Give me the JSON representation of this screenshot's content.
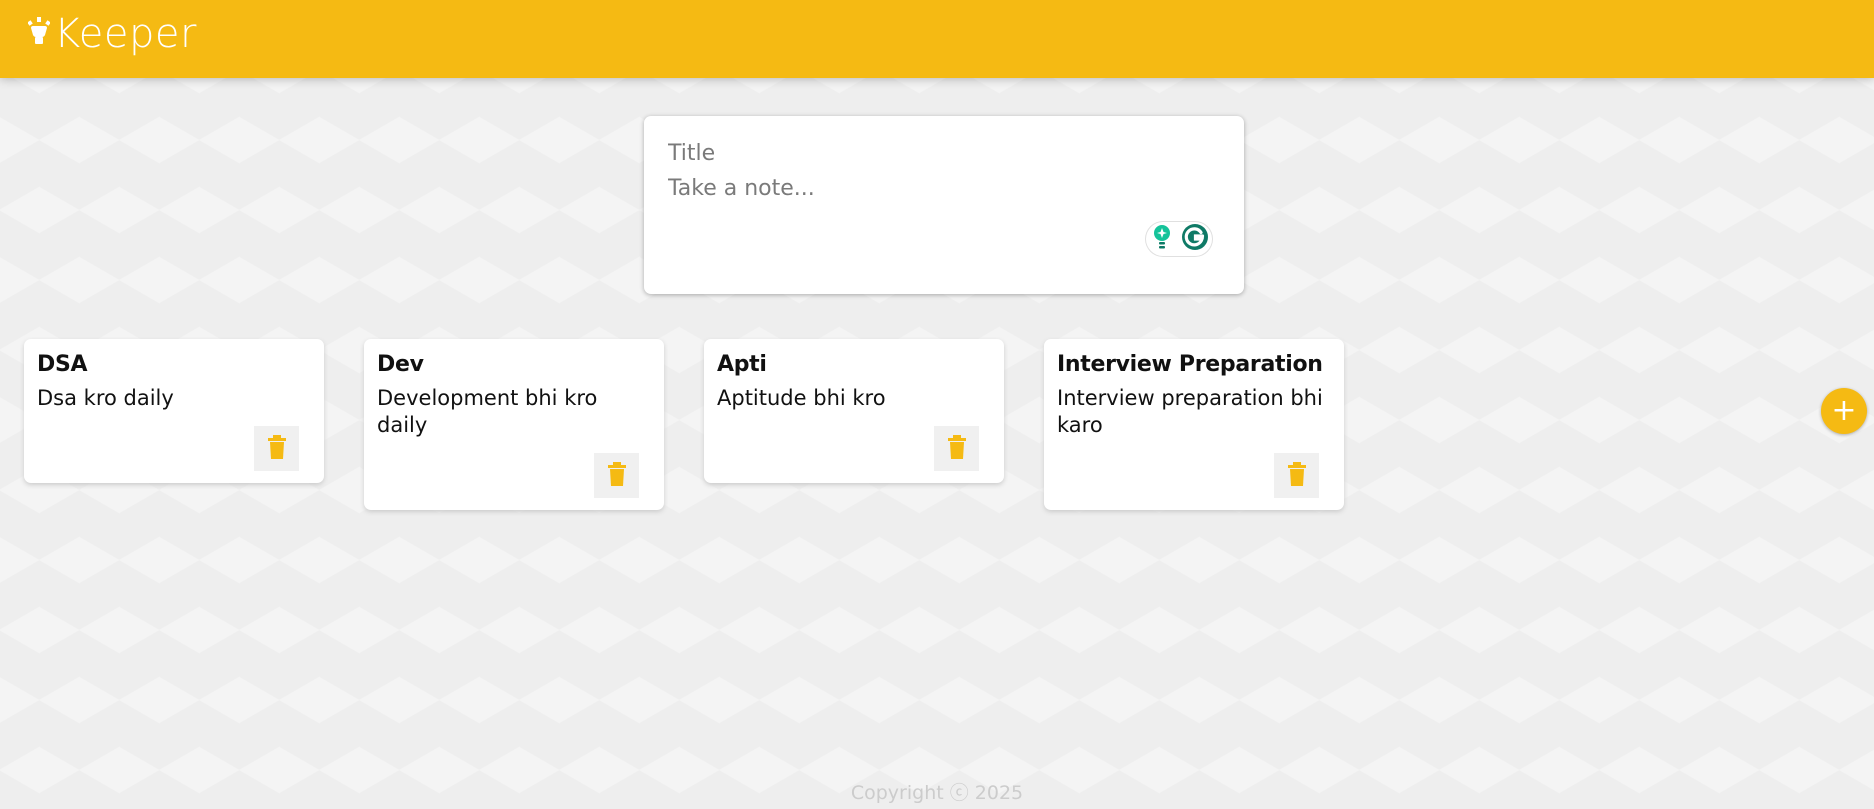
{
  "header": {
    "logo_icon": "lightbulb-icon",
    "app_name": "Keeper",
    "bg_color": "#f5ba13"
  },
  "create_note": {
    "title_placeholder": "Title",
    "content_placeholder": "Take a note...",
    "title_value": "",
    "content_value": "",
    "add_icon": "plus-icon",
    "add_label": "+",
    "extension_icons": [
      "grammarly-suggestion-icon",
      "grammarly-icon"
    ]
  },
  "notes": [
    {
      "title": "DSA",
      "content": "Dsa kro daily",
      "delete_icon": "trash-icon"
    },
    {
      "title": "Dev",
      "content": "Development bhi kro daily",
      "delete_icon": "trash-icon"
    },
    {
      "title": "Apti",
      "content": "Aptitude bhi kro",
      "delete_icon": "trash-icon"
    },
    {
      "title": "Interview Preparation",
      "content": "Interview preparation bhi karo",
      "delete_icon": "trash-icon"
    }
  ],
  "footer": {
    "copyright": "Copyright ⓒ 2025"
  },
  "colors": {
    "accent": "#f5ba13",
    "background": "#eeeeee",
    "card": "#ffffff",
    "grammarly_green": "#15c39a",
    "grammarly_dark": "#0f7a66"
  }
}
